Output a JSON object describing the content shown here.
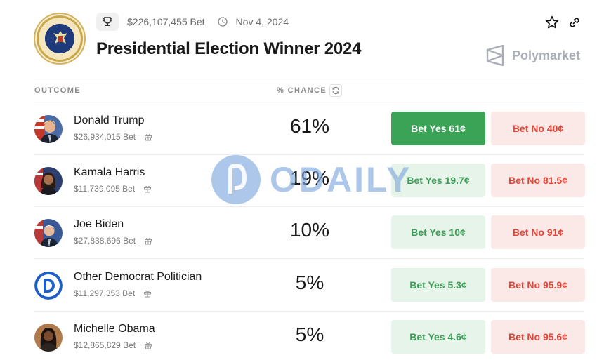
{
  "header": {
    "volume": "$226,107,455 Bet",
    "date": "Nov 4, 2024",
    "title": "Presidential Election Winner 2024",
    "brand": "Polymarket"
  },
  "columns": {
    "outcome": "OUTCOME",
    "chance": "% CHANCE"
  },
  "outcomes": [
    {
      "name": "Donald Trump",
      "bet": "$26,934,015 Bet",
      "chance": "61%",
      "yes": "Bet Yes 61¢",
      "no": "Bet No 40¢"
    },
    {
      "name": "Kamala Harris",
      "bet": "$11,739,095 Bet",
      "chance": "19%",
      "yes": "Bet Yes 19.7¢",
      "no": "Bet No 81.5¢"
    },
    {
      "name": "Joe Biden",
      "bet": "$27,838,696 Bet",
      "chance": "10%",
      "yes": "Bet Yes 10¢",
      "no": "Bet No 91¢"
    },
    {
      "name": "Other Democrat Politician",
      "bet": "$11,297,353 Bet",
      "chance": "5%",
      "yes": "Bet Yes 5.3¢",
      "no": "Bet No 95.9¢"
    },
    {
      "name": "Michelle Obama",
      "bet": "$12,865,829 Bet",
      "chance": "5%",
      "yes": "Bet Yes 4.6¢",
      "no": "Bet No 95.6¢"
    }
  ],
  "watermark": "ODAILY",
  "icons": [
    "trophy-icon",
    "clock-icon",
    "star-icon",
    "link-icon",
    "refresh-icon",
    "gift-icon",
    "polymarket-logo-icon"
  ],
  "colors": {
    "yes_active": "#3aa356",
    "yes": "#e6f4e9",
    "no": "#fbe9e7",
    "no_text": "#e2483a"
  }
}
